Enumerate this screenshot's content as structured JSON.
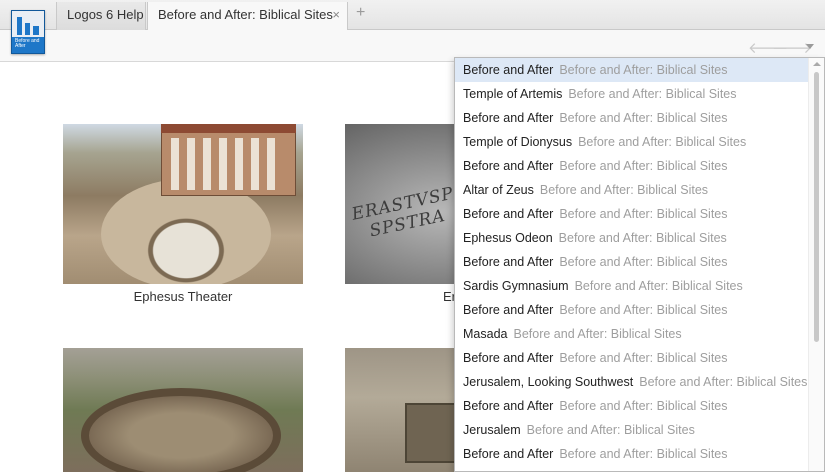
{
  "tabs": [
    {
      "label": "Logos 6 Help",
      "active": false
    },
    {
      "label": "Before and After: Biblical Sites",
      "active": true
    }
  ],
  "app_icon": {
    "title": "Before and After",
    "color": "#1e77c8"
  },
  "icons": {
    "tab_close": "×",
    "tab_add": "+",
    "nav_back": "🡐",
    "nav_forward": "🡒"
  },
  "gallery": {
    "captions": [
      "Ephesus Theater",
      "Erastus"
    ],
    "erastus_inscription": [
      "ERASTVSP",
      "SPSTRA"
    ]
  },
  "dropdown": {
    "selected_index": 0,
    "items": [
      {
        "title": "Before and After",
        "subtitle": "Before and After: Biblical Sites"
      },
      {
        "title": "Temple of Artemis",
        "subtitle": "Before and After: Biblical Sites"
      },
      {
        "title": "Before and After",
        "subtitle": "Before and After: Biblical Sites"
      },
      {
        "title": "Temple of Dionysus",
        "subtitle": "Before and After: Biblical Sites"
      },
      {
        "title": "Before and After",
        "subtitle": "Before and After: Biblical Sites"
      },
      {
        "title": "Altar of Zeus",
        "subtitle": "Before and After: Biblical Sites"
      },
      {
        "title": "Before and After",
        "subtitle": "Before and After: Biblical Sites"
      },
      {
        "title": "Ephesus Odeon",
        "subtitle": "Before and After: Biblical Sites"
      },
      {
        "title": "Before and After",
        "subtitle": "Before and After: Biblical Sites"
      },
      {
        "title": "Sardis Gymnasium",
        "subtitle": "Before and After: Biblical Sites"
      },
      {
        "title": "Before and After",
        "subtitle": "Before and After: Biblical Sites"
      },
      {
        "title": "Masada",
        "subtitle": "Before and After: Biblical Sites"
      },
      {
        "title": "Before and After",
        "subtitle": "Before and After: Biblical Sites"
      },
      {
        "title": "Jerusalem, Looking Southwest",
        "subtitle": "Before and After: Biblical Sites"
      },
      {
        "title": "Before and After",
        "subtitle": "Before and After: Biblical Sites"
      },
      {
        "title": "Jerusalem",
        "subtitle": "Before and After: Biblical Sites"
      },
      {
        "title": "Before and After",
        "subtitle": "Before and After: Biblical Sites"
      }
    ]
  },
  "colors": {
    "selected_row": "#dde8f6",
    "subtitle_text": "#9e9e9e",
    "brand_blue": "#1e77c8"
  }
}
